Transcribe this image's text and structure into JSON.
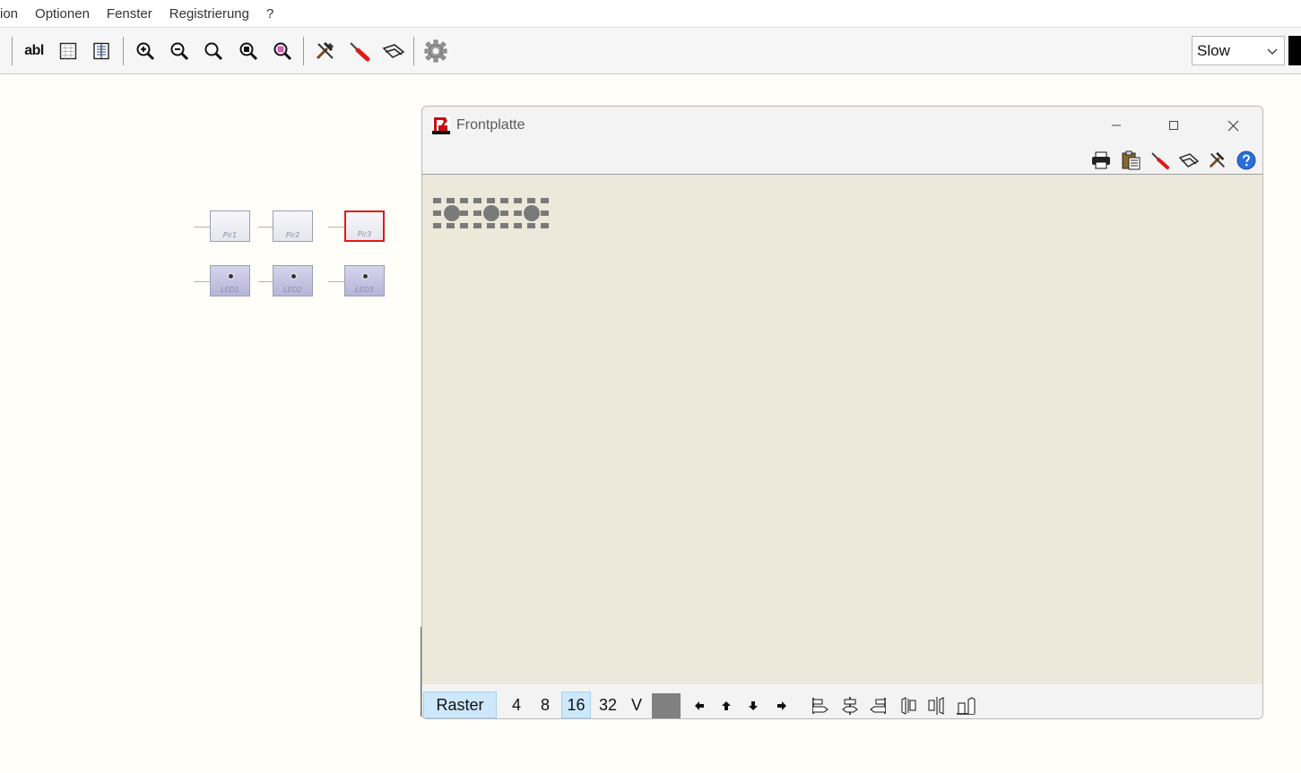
{
  "menu": {
    "items": [
      "ion",
      "Optionen",
      "Fenster",
      "Registrierung",
      "?"
    ]
  },
  "toolbar": {
    "text_tool_label": "abl",
    "icons": [
      "text-tool-icon",
      "grid-icon",
      "page-view-icon",
      "zoom-in-icon",
      "zoom-out-icon",
      "zoom-icon",
      "zoom-fit-icon",
      "zoom-selection-icon",
      "tools-icon",
      "probe-icon",
      "eraser-icon",
      "settings-gear-icon"
    ],
    "speed_value": "Slow"
  },
  "circuit": {
    "pir_labels": [
      "Pir1",
      "Pir2",
      "Pir3"
    ],
    "led_labels": [
      "LED1",
      "LED2",
      "LED3"
    ],
    "selected": "Pir3"
  },
  "frontplatte": {
    "title": "Frontplatte",
    "tool_icons": [
      "print-icon",
      "clipboard-icon",
      "probe-icon",
      "eraser-icon",
      "tools-icon",
      "help-icon"
    ],
    "raster_label": "Raster",
    "raster_options": [
      "4",
      "8",
      "16",
      "32",
      "V"
    ],
    "raster_active": "16",
    "color_swatch": "#808080",
    "bottom_icons": [
      "arrow-left-icon",
      "arrow-up-icon",
      "arrow-down-icon",
      "arrow-right-icon",
      "align-left-icon",
      "align-center-icon",
      "align-right-icon",
      "distribute-left-icon",
      "distribute-center-icon",
      "distribute-right-icon"
    ]
  },
  "colors": {
    "selection_red": "#e01a1a",
    "panel_bg": "#ece8da",
    "active_blue": "#cde8fb"
  }
}
